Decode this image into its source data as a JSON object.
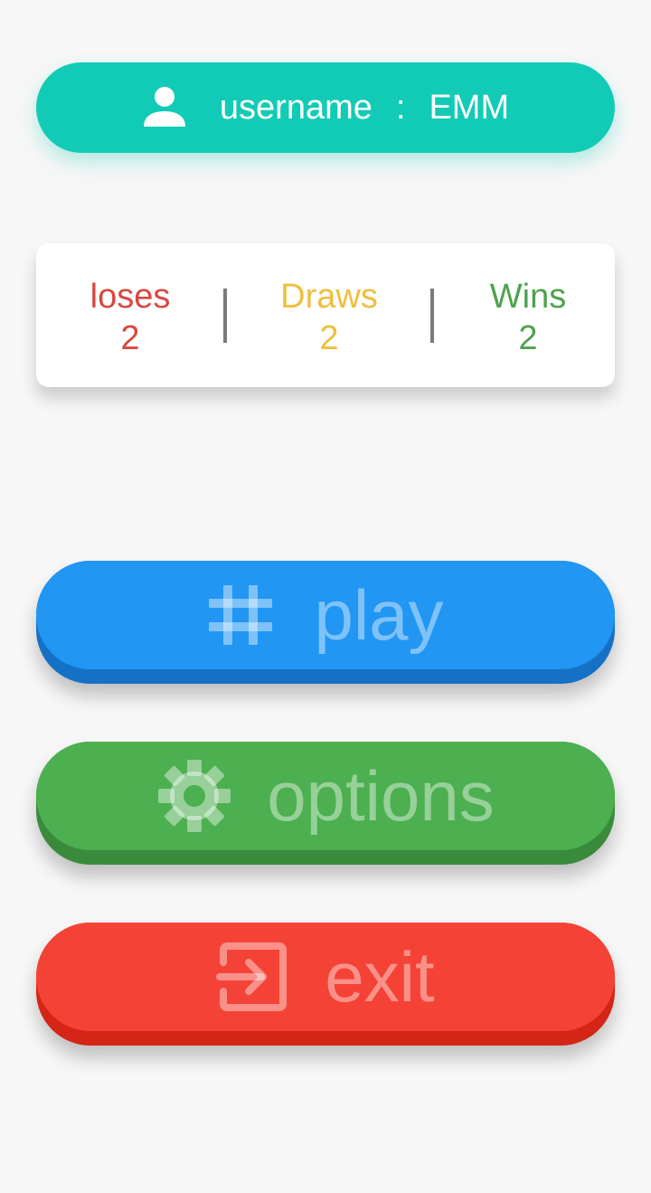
{
  "user": {
    "label": "username",
    "separator": ":",
    "name": "EMM",
    "icon": "person-icon"
  },
  "stats": {
    "loses": {
      "label": "loses",
      "value": "2"
    },
    "draws": {
      "label": "Draws",
      "value": "2"
    },
    "wins": {
      "label": "Wins",
      "value": "2"
    }
  },
  "buttons": {
    "play": {
      "label": "play",
      "icon": "grid-hash-icon"
    },
    "options": {
      "label": "options",
      "icon": "gear-icon"
    },
    "exit": {
      "label": "exit",
      "icon": "exit-icon"
    }
  },
  "colors": {
    "user_pill": "#12cbb6",
    "loses": "#d9473f",
    "draws": "#efbf3c",
    "wins": "#4ea24e",
    "play": "#2196f3",
    "options": "#4caf50",
    "exit": "#f44336"
  }
}
